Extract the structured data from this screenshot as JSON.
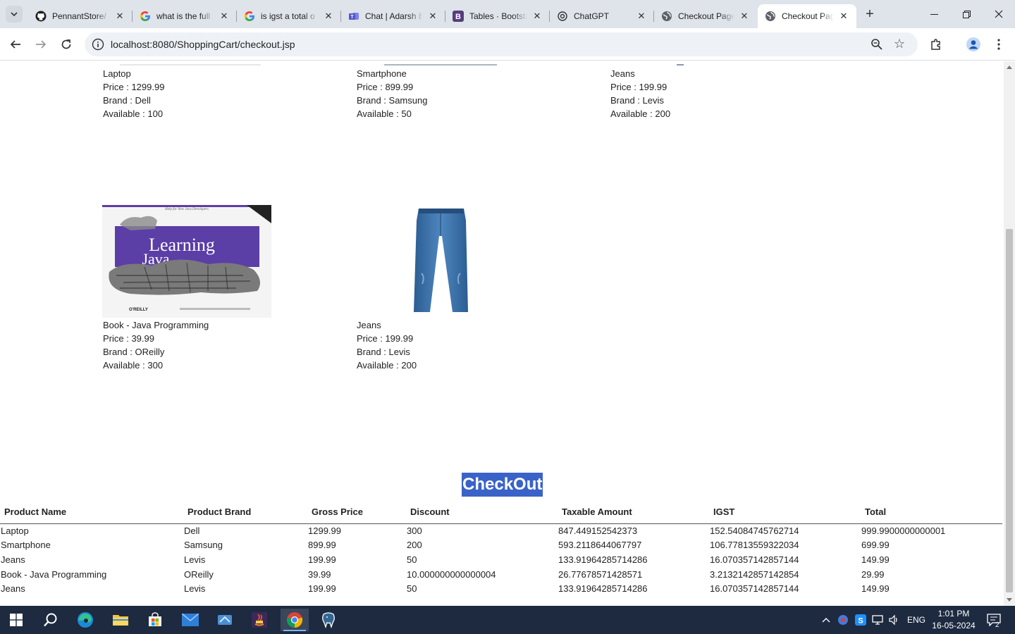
{
  "browser": {
    "tabs": [
      {
        "title": "PennantStore/",
        "icon": "github-icon"
      },
      {
        "title": "what is the full",
        "icon": "google-icon"
      },
      {
        "title": "is igst a total o",
        "icon": "google-icon"
      },
      {
        "title": "Chat | Adarsh B",
        "icon": "teams-icon"
      },
      {
        "title": "Tables · Bootstr",
        "icon": "bootstrap-icon"
      },
      {
        "title": "ChatGPT",
        "icon": "chatgpt-icon"
      },
      {
        "title": "Checkout Page",
        "icon": "globe-icon"
      },
      {
        "title": "Checkout Page",
        "icon": "globe-icon",
        "active": true
      }
    ],
    "url": "localhost:8080/ShoppingCart/checkout.jsp"
  },
  "products_top": [
    {
      "name": "Laptop",
      "price": "Price : 1299.99",
      "brand": "Brand : Dell",
      "available": "Available : 100"
    },
    {
      "name": "Smartphone",
      "price": "Price : 899.99",
      "brand": "Brand : Samsung",
      "available": "Available : 50"
    },
    {
      "name": "Jeans",
      "price": "Price : 199.99",
      "brand": "Brand : Levis",
      "available": "Available : 200"
    }
  ],
  "products_bottom": [
    {
      "name": "Book - Java Programming",
      "price": "Price : 39.99",
      "brand": "Brand : OReilly",
      "available": "Available : 300",
      "image": "book-cover",
      "cover": {
        "top": "Help for New Java Developers",
        "title_line1": "Learning",
        "title_line2": "Java",
        "publisher": "O'REILLY"
      }
    },
    {
      "name": "Jeans",
      "price": "Price : 199.99",
      "brand": "Brand : Levis",
      "available": "Available : 200",
      "image": "jeans"
    }
  ],
  "checkout": {
    "title": "CheckOut",
    "headers": [
      "Product Name",
      "Product Brand",
      "Gross Price",
      "Discount",
      "Taxable Amount",
      "IGST",
      "Total"
    ],
    "rows": [
      [
        "Laptop",
        "Dell",
        "1299.99",
        "300",
        "847.449152542373",
        "152.54084745762714",
        "999.9900000000001"
      ],
      [
        "Smartphone",
        "Samsung",
        "899.99",
        "200",
        "593.2118644067797",
        "106.77813559322034",
        "699.99"
      ],
      [
        "Jeans",
        "Levis",
        "199.99",
        "50",
        "133.91964285714286",
        "16.070357142857144",
        "149.99"
      ],
      [
        "Book - Java Programming",
        "OReilly",
        "39.99",
        "10.000000000000004",
        "26.77678571428571",
        "3.2132142857142854",
        "29.99"
      ],
      [
        "Jeans",
        "Levis",
        "199.99",
        "50",
        "133.91964285714286",
        "16.070357142857144",
        "149.99"
      ]
    ]
  },
  "taskbar": {
    "apps": [
      "windows-start-icon",
      "search-icon",
      "edge-icon",
      "file-explorer-icon",
      "store-icon",
      "mail-icon",
      "vmware-icon",
      "java-icon",
      "chrome-icon",
      "postgres-icon"
    ],
    "tray": {
      "language": "ENG",
      "time": "1:01 PM",
      "date": "16-05-2024",
      "notifications": "2"
    }
  },
  "colors": {
    "selection": "#3a63c8",
    "taskbar": "#1d2a40",
    "tabstrip": "#dfe3ea"
  }
}
